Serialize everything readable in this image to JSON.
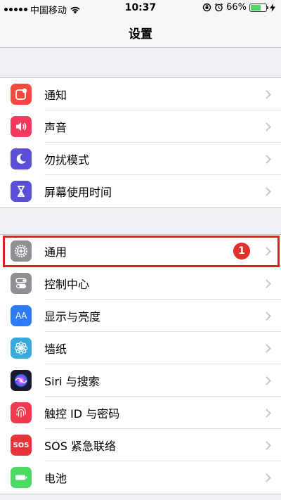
{
  "status_bar": {
    "carrier": "中国移动",
    "time": "10:37",
    "battery": "66%"
  },
  "nav": {
    "title": "设置"
  },
  "groups": [
    {
      "items": [
        {
          "label": "通知",
          "icon": "notifications-icon",
          "color": "#f24a3e"
        },
        {
          "label": "声音",
          "icon": "sounds-icon",
          "color": "#f43a5e"
        },
        {
          "label": "勿扰模式",
          "icon": "do-not-disturb-moon-icon",
          "color": "#5b4fd6"
        },
        {
          "label": "屏幕使用时间",
          "icon": "screen-time-hourglass-icon",
          "color": "#5b4fd6"
        }
      ]
    },
    {
      "items": [
        {
          "label": "通用",
          "icon": "general-gear-icon",
          "color": "#8e8e93",
          "badge": "1"
        },
        {
          "label": "控制中心",
          "icon": "control-center-icon",
          "color": "#8e8e93"
        },
        {
          "label": "显示与亮度",
          "icon": "display-brightness-icon",
          "color": "#2c7cf6",
          "icon_text": "AA"
        },
        {
          "label": "墙纸",
          "icon": "wallpaper-flower-icon",
          "color": "#36aadc"
        },
        {
          "label": "Siri 与搜索",
          "icon": "siri-icon",
          "color": "#1a1a2e"
        },
        {
          "label": "触控 ID 与密码",
          "icon": "touch-id-fingerprint-icon",
          "color": "#f0394e"
        },
        {
          "label": "SOS 紧急联络",
          "icon": "sos-icon",
          "color": "#e8333a",
          "icon_text": "SOS"
        },
        {
          "label": "电池",
          "icon": "battery-icon",
          "color": "#4cd964"
        }
      ]
    }
  ]
}
